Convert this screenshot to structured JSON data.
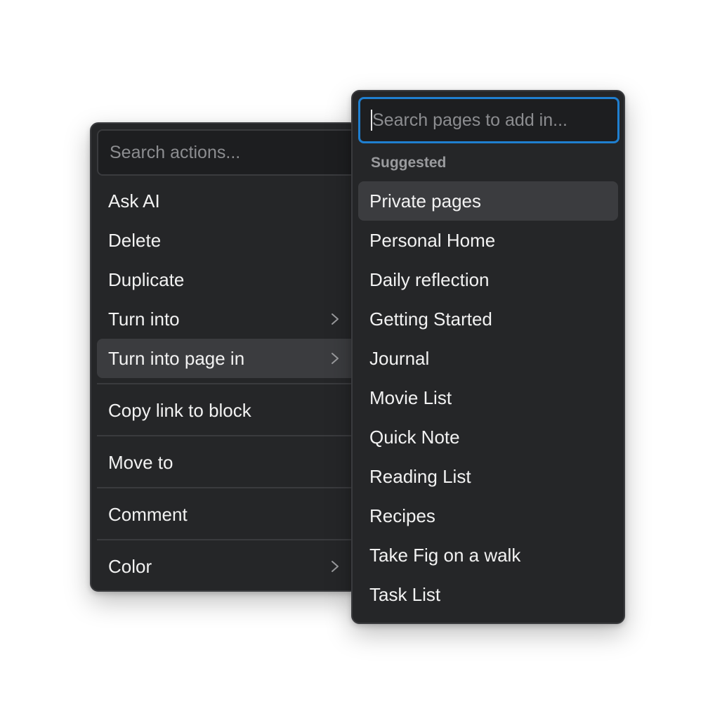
{
  "action_menu": {
    "search_placeholder": "Search actions...",
    "items": [
      {
        "label": "Ask AI"
      },
      {
        "label": "Delete"
      },
      {
        "label": "Duplicate"
      },
      {
        "label": "Turn into"
      },
      {
        "label": "Turn into page in"
      },
      {
        "label": "Copy link to block"
      },
      {
        "label": "Move to"
      },
      {
        "label": "Comment"
      },
      {
        "label": "Color"
      }
    ],
    "highlighted_item": "Turn into page in"
  },
  "page_menu": {
    "search_placeholder": "Search pages to add in...",
    "section_label": "Suggested",
    "pages": [
      "Private pages",
      "Personal Home",
      "Daily reflection",
      "Getting Started",
      "Journal",
      "Movie List",
      "Quick Note",
      "Reading List",
      "Recipes",
      "Take Fig on a walk",
      "Task List"
    ],
    "highlighted_page": "Private pages"
  },
  "colors": {
    "menu_background": "#252628",
    "highlight": "#3b3c3f",
    "focus_ring": "#1f7fd0",
    "text": "#f2f2f2",
    "muted_text": "#8c8d90"
  },
  "icons": {
    "submenu_indicator": "chevron-right-icon",
    "text_cursor": "text-caret"
  }
}
